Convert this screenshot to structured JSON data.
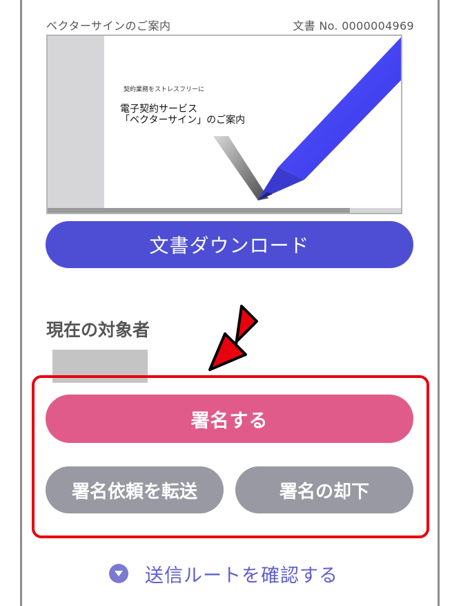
{
  "document": {
    "title": "ベクターサインのご案内",
    "number": "文書 No. 0000004969",
    "preview": {
      "small_text": "契約業務をストレスフリーに",
      "heading_line1": "電子契約サービス",
      "heading_line2": "「ベクターサイン」のご案内"
    }
  },
  "buttons": {
    "download": "文書ダウンロード",
    "sign": "署名する",
    "forward": "署名依頼を転送",
    "reject": "署名の却下"
  },
  "target": {
    "label": "現在の対象者"
  },
  "route": {
    "label": "送信ルートを確認する",
    "icon": "chevron-down-circle-icon"
  },
  "colors": {
    "primary": "#4d4ed4",
    "sign": "#e05b8a",
    "secondary": "#9999a3",
    "highlight": "#e8000e",
    "link": "#5f5fcf"
  }
}
